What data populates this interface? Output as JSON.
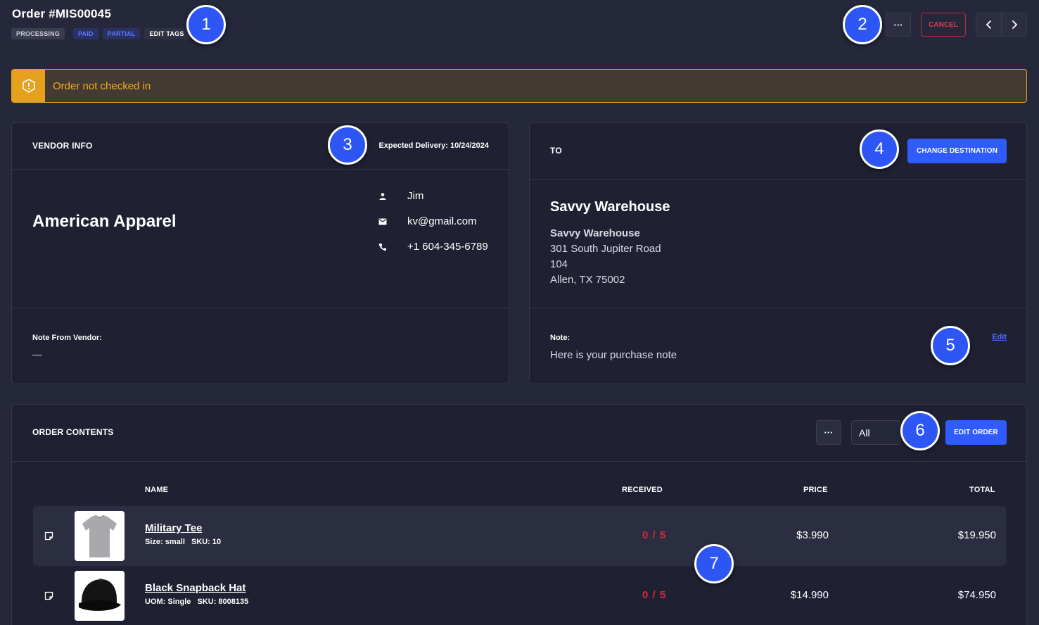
{
  "header": {
    "order_title": "Order #MIS00045",
    "tags": [
      "PROCESSING",
      "PAID",
      "PARTIAL",
      "EDIT TAGS"
    ],
    "more_label": "···",
    "cancel_label": "CANCEL",
    "prev_icon": "chevron-left-icon",
    "next_icon": "chevron-right-icon"
  },
  "alert": {
    "icon": "warning-icon",
    "text": "Order not checked in",
    "color": "#e5a11e"
  },
  "vendor": {
    "title": "VENDOR INFO",
    "expected_delivery": "Expected Delivery: 10/24/2024",
    "name": "American Apparel",
    "contact_name": "Jim",
    "email": "kv@gmail.com",
    "phone": "+1 604-345-6789",
    "note_label": "Note From Vendor:",
    "note_value": "—"
  },
  "destination": {
    "title": "TO",
    "change_label": "CHANGE DESTINATION",
    "name": "Savvy Warehouse",
    "address_name": "Savvy Warehouse",
    "address_line1": "301 South Jupiter Road",
    "address_line2": "104",
    "address_line3": "Allen, TX 75002",
    "note_label": "Note:",
    "note_value": "Here is your purchase note",
    "edit_label": "Edit"
  },
  "contents": {
    "title": "ORDER CONTENTS",
    "more_label": "···",
    "filter_value": "All",
    "edit_label": "EDIT ORDER",
    "columns": {
      "name": "NAME",
      "received": "RECEIVED",
      "price": "PRICE",
      "total": "TOTAL"
    },
    "items": [
      {
        "name": "Military Tee",
        "meta1_label": "Size:",
        "meta1_value": "small",
        "meta2_label": "SKU:",
        "meta2_value": "10",
        "received": "0 / 5",
        "price": "$3.990",
        "total": "$19.950"
      },
      {
        "name": "Black Snapback Hat",
        "meta1_label": "UOM:",
        "meta1_value": "Single",
        "meta2_label": "SKU:",
        "meta2_value": "8008135",
        "received": "0 / 5",
        "price": "$14.990",
        "total": "$74.950"
      }
    ]
  },
  "markers": [
    "1",
    "2",
    "3",
    "4",
    "5",
    "6",
    "7"
  ],
  "colors": {
    "background": "#25273a",
    "card": "#1f2132",
    "primary": "#2f5bff",
    "danger": "#d5283f",
    "warning": "#e5a11e"
  }
}
